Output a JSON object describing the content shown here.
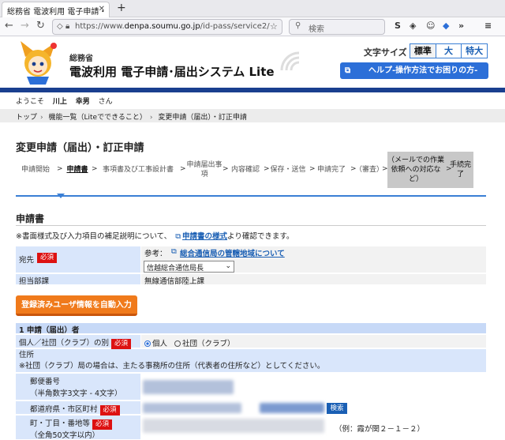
{
  "browser": {
    "tab_title": "総務省 電波利用 電子申請・",
    "url_prefix": "https://www.",
    "url_domain": "denpa.soumu.go.jp",
    "url_rest": "/id-pass/service2/",
    "search_placeholder": "検索"
  },
  "header": {
    "ministry": "総務省",
    "system_title": "電波利用 電子申請･届出システム Lite",
    "font_size_label": "文字サイズ",
    "font_sizes": [
      "標準",
      "大",
      "特大"
    ],
    "help_button": "ヘルプ-操作方法でお困りの方-"
  },
  "welcome": {
    "greeting": "ようこそ",
    "last_name": "川上",
    "first_name": "幸男",
    "honorific": "さん"
  },
  "breadcrumb": [
    "トップ",
    "機能一覧（Liteでできること）",
    "変更申請（届出）・訂正申請"
  ],
  "page_title": "変更申請（届出）・訂正申請",
  "steps": [
    "申請開始",
    "申請書",
    "事項書及び工事設計書",
    "申請届出事項",
    "内容確認",
    "保存・送信",
    "申請完了",
    "（審査）",
    "（メールでの作業依頼への対応など）",
    "手続完了"
  ],
  "section": {
    "title": "申請書",
    "note_prefix": "※書面様式及び入力項目の補足説明について、",
    "note_link": "申請書の様式",
    "note_suffix": "より確認できます。"
  },
  "form": {
    "required": "必須",
    "destination_label": "宛先",
    "reference_prefix": "参考：",
    "reference_link": "総合通信局の管轄地域について",
    "destination_value": "信越総合通信局長",
    "department_label": "担当部課",
    "department_value": "無線通信部陸上課",
    "autofill_button": "登録済みユーザ情報を自動入力",
    "applicant_section": "1 申請（届出）者",
    "type_label": "個人／社団（クラブ）の別",
    "type_individual": "個人",
    "type_club": "社団（クラブ）",
    "address_label": "住所",
    "address_note": "※社団（クラブ）局の場合は、主たる事務所の住所（代表者の住所など）としてください。",
    "postal_label": "郵便番号",
    "postal_hint": "（半角数字3文字 - 4文字）",
    "pref_label": "都道府県・市区町村",
    "search_button": "検索",
    "street_label": "町・丁目・番地等",
    "street_hint": "（全角50文字以内）",
    "street_example": "（例：霞が関２－１－２）"
  }
}
